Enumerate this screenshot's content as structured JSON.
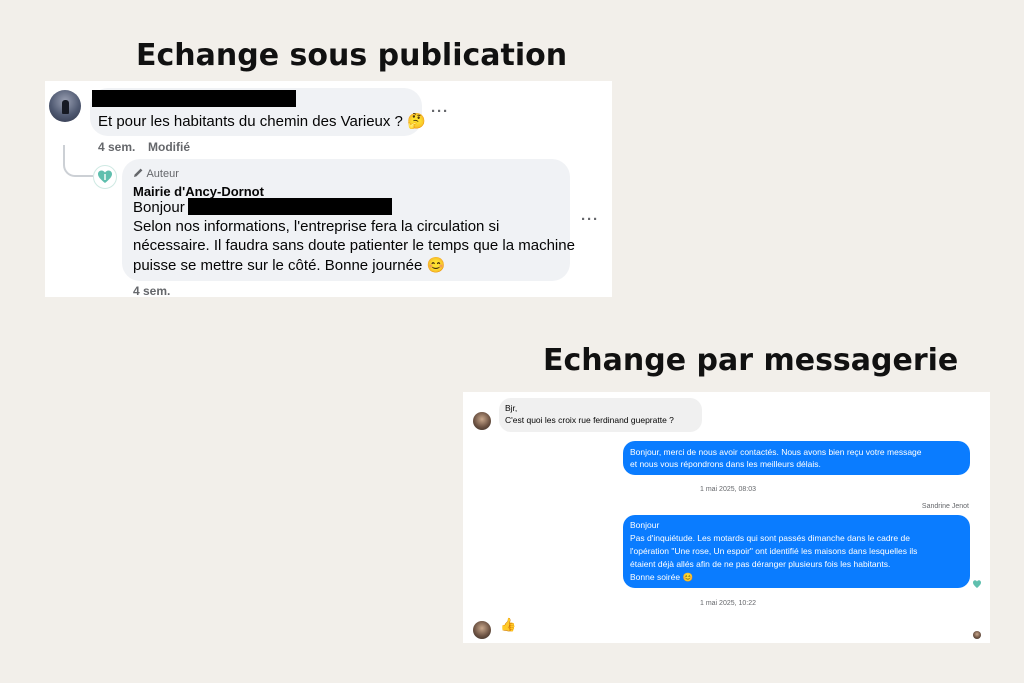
{
  "headings": {
    "publication": "Echange sous publication",
    "messagerie": "Echange par messagerie"
  },
  "publication": {
    "comment1": {
      "text": "Et pour les habitants du chemin des Varieux ? 🤔",
      "time": "4 sem.",
      "edited": "Modifié",
      "more": "···"
    },
    "reply": {
      "badge": "Auteur",
      "author": "Mairie d'Ancy-Dornot",
      "greeting": "Bonjour",
      "lines": [
        "Selon nos informations, l'entreprise fera la circulation si",
        "nécessaire. Il faudra sans doute patienter le temps que la machine",
        "puisse se mettre sur le côté. Bonne journée 😊"
      ],
      "time": "4 sem.",
      "more": "···"
    }
  },
  "messagerie": {
    "incoming": {
      "lines": [
        "Bjr,",
        "C'est quoi les croix rue ferdinand guepratte ?"
      ]
    },
    "auto_reply": {
      "lines": [
        "Bonjour, merci de nous avoir contactés. Nous avons bien reçu votre message",
        "et nous vous répondrons dans les meilleurs délais."
      ]
    },
    "timestamp1": "1 mai 2025, 08:03",
    "sender": "Sandrine Jenot",
    "reply": {
      "lines": [
        "Bonjour",
        "Pas d'inquiétude. Les motards qui sont passés dimanche dans le cadre de",
        "l'opération \"Une rose, Un espoir\" ont identifié les maisons dans lesquelles ils",
        "étaient déjà allés afin de ne pas déranger plusieurs fois les habitants.",
        "Bonne soirée 😊"
      ]
    },
    "timestamp2": "1 mai 2025, 10:22",
    "like": "👍"
  },
  "colors": {
    "page_bg": "#f2efea",
    "messenger_blue": "#0a7cff",
    "bubble_grey": "#f0f2f5",
    "mairie_teal": "#5fbfae"
  }
}
